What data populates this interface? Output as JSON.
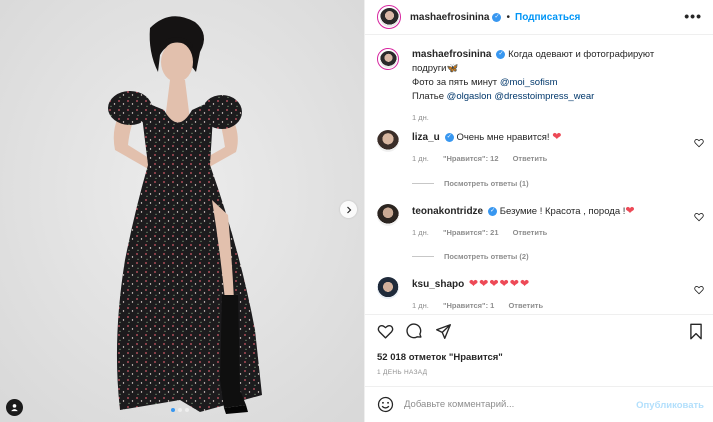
{
  "post": {
    "author": "mashaefrosinina",
    "follow_label": "Подписаться",
    "header_separator": "•",
    "more_label": "•••",
    "caption": {
      "text_before": "Когда одевают и фотографируют подруги",
      "emoji": "🦋",
      "line2_prefix": "Фото за пять минут",
      "line2_mention": "@moi_sofism",
      "line3_prefix": "Платье",
      "line3_mention1": "@olgaslon",
      "line3_mention2": "@dresstoimpress_wear",
      "time": "1 дн."
    },
    "likes_text": "52 018 отметок \"Нравится\"",
    "date_text": "1 ДЕНЬ НАЗАД",
    "add_comment_placeholder": "Добавьте комментарий...",
    "publish_label": "Опубликовать"
  },
  "comments": [
    {
      "username": "liza_u",
      "text": "Очень мне нравится!",
      "emoji": "❤",
      "time": "1 дн.",
      "likes": "\"Нравится\": 12",
      "reply_label": "Ответить",
      "view_replies": "Посмотреть ответы (1)"
    },
    {
      "username": "teonakontridze",
      "text": "Безумие ! Красота , порода !",
      "emoji": "❤",
      "time": "1 дн.",
      "likes": "\"Нравится\": 21",
      "reply_label": "Ответить",
      "view_replies": "Посмотреть ответы (2)"
    },
    {
      "username": "ksu_shapo",
      "text": "",
      "emoji": "❤❤❤❤❤❤",
      "time": "1 дн.",
      "likes": "\"Нравится\": 1",
      "reply_label": "Ответить"
    }
  ],
  "carousel": {
    "slides": 3,
    "active_index": 0
  },
  "icons": [
    "heart-icon",
    "comment-icon",
    "share-icon",
    "bookmark-icon",
    "emoji-icon",
    "user-tag-icon",
    "chevron-right-icon",
    "more-icon",
    "verified-icon"
  ],
  "colors": {
    "accent": "#0095f6",
    "link": "#00376b",
    "heart_red": "#ed4956",
    "muted": "#8e8e8e",
    "publish_disabled": "#b2dffc"
  }
}
